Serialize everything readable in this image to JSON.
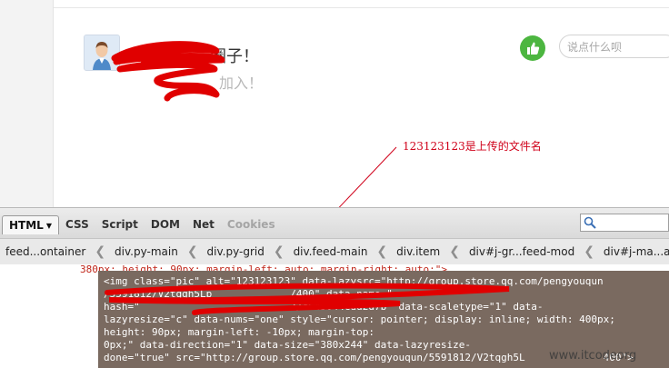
{
  "feed": {
    "title_visible": "圈子！",
    "subtitle_visible": "加入！",
    "comment_placeholder": "说点什么呗"
  },
  "annotation": {
    "text": "123123123是上传的文件名",
    "color": "#d0021b"
  },
  "firebug": {
    "tabs": [
      {
        "label": "HTML",
        "active": true
      },
      {
        "label": "CSS",
        "active": false
      },
      {
        "label": "Script",
        "active": false
      },
      {
        "label": "DOM",
        "active": false
      },
      {
        "label": "Net",
        "active": false
      },
      {
        "label": "Cookies",
        "active": false,
        "disabled": true
      }
    ],
    "breadcrumbs": [
      "feed...ontainer",
      "div.py-main",
      "div.py-grid",
      "div.feed-main",
      "div.item",
      "div#j-gr...feed-mod",
      "div#j-ma...ain-wrap"
    ],
    "prev_line": "380px; height: 90px; margin-left: auto; margin-right: auto;\">",
    "selected_lines": [
      "<img class=\"pic\" alt=\"123123123\" data-lazysrc=\"http://group.store.qq.com/pengyouqun",
      "/5591812/V2tqgh5Lp             /400\" data-name=\"",
      "hash=\"                         7/4543044cdd2d7b\" data-scaletype=\"1\" data-",
      "lazyresize=\"c\" data-nums=\"one\" style=\"cursor: pointer; display: inline; width: 400px;",
      "height: 90px; margin-left: -10px; margin-top:",
      "0px;\" data-direction=\"1\" data-size=\"380x244\" data-lazyresize-",
      "done=\"true\" src=\"http://group.store.qq.com/pengyouqun/5591812/V2tqgh5L             400\">"
    ],
    "selected_bg": "#7a6a60"
  },
  "watermark": "www.itcodeorg",
  "colors": {
    "like_green": "#4cb640",
    "scribble_red": "#e00000"
  }
}
